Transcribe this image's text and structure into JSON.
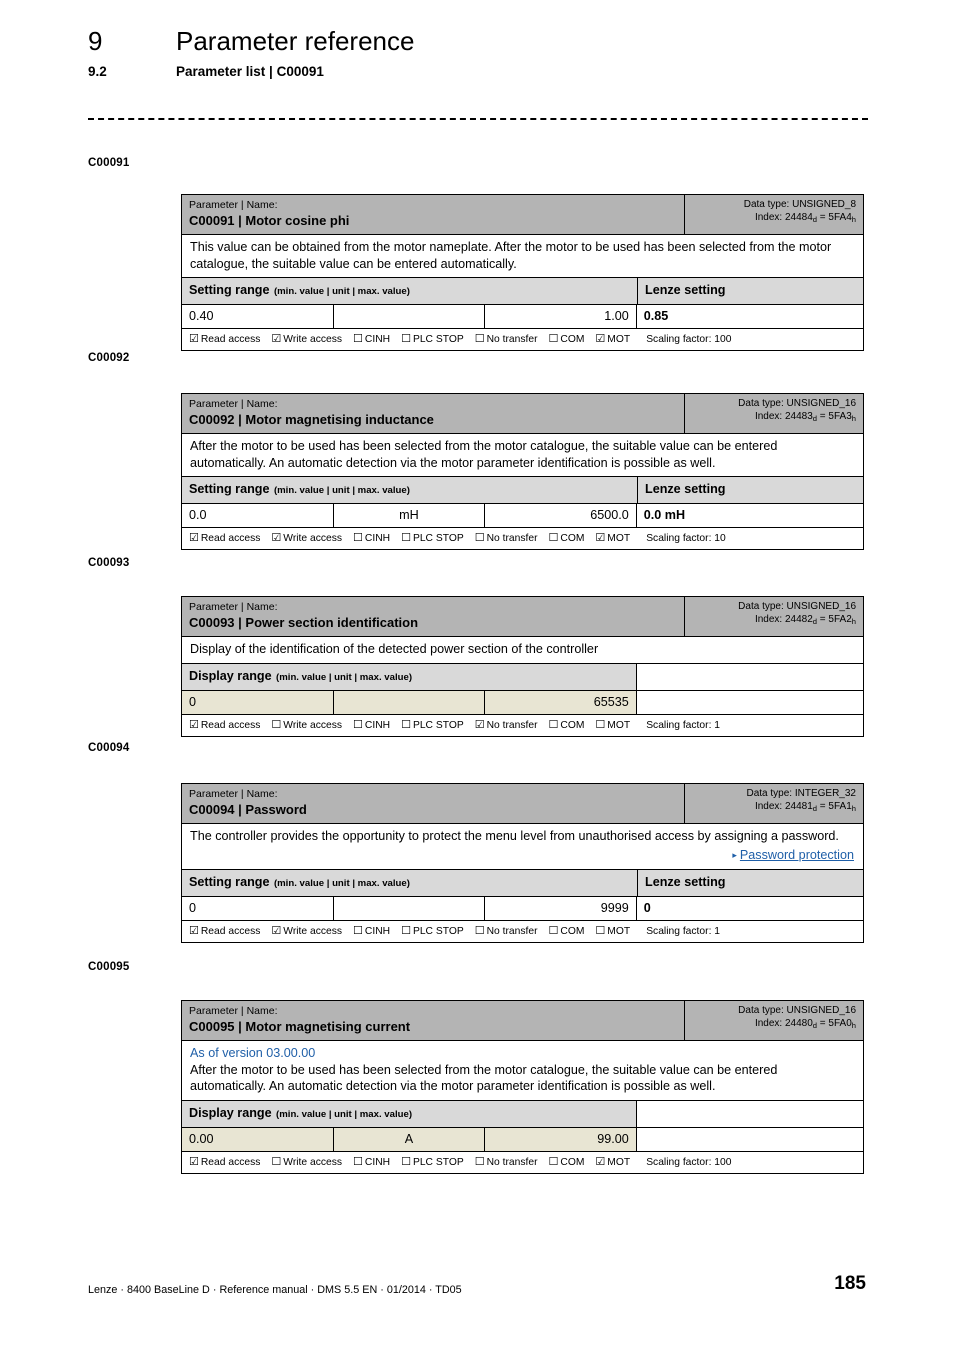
{
  "header": {
    "chapter_number": "9",
    "chapter_title": "Parameter reference",
    "section_number": "9.2",
    "section_title": "Parameter list | C00091"
  },
  "colors": {
    "header_band": "#B4B4B4",
    "range_band": "#D9D9D9",
    "value_beige": "#E8E5D3",
    "link_blue": "#1F5FA8"
  },
  "labels": {
    "parameter_name_kicker": "Parameter | Name:",
    "data_type_prefix": "Data type: ",
    "index_prefix": "Index: ",
    "setting_range": "Setting range",
    "display_range": "Display range",
    "range_sub": "(min. value | unit | max. value)",
    "lenze_setting": "Lenze setting",
    "read_access": "Read access",
    "write_access": "Write access",
    "cinh": "CINH",
    "plc_stop": "PLC STOP",
    "no_transfer": "No transfer",
    "com": "COM",
    "mot": "MOT",
    "scaling_factor_prefix": "Scaling factor: ",
    "checked_glyph": "☑",
    "unchecked_glyph": "☐",
    "xref_arrow_glyph": "▸"
  },
  "parameters": [
    {
      "margin_tag": "C00091",
      "code": "C00091",
      "name": "C00091 | Motor cosine phi",
      "data_type": "UNSIGNED_8",
      "index_dec": "24484",
      "index_hex": "5FA4",
      "description": "This value can be obtained from the motor nameplate. After the motor to be used has been selected from the motor catalogue, the suitable value can be entered automatically.",
      "as_of_version": "",
      "xref": "",
      "range_type": "Setting range",
      "min": "0.40",
      "unit": "",
      "max": "1.00",
      "lenze_value": "0.85",
      "has_lenze": true,
      "access": {
        "read": true,
        "write": true,
        "cinh": false,
        "plc_stop": false,
        "no_transfer": false,
        "com": false,
        "mot": true
      },
      "scaling_factor": "100"
    },
    {
      "margin_tag": "C00092",
      "code": "C00092",
      "name": "C00092 | Motor magnetising inductance",
      "data_type": "UNSIGNED_16",
      "index_dec": "24483",
      "index_hex": "5FA3",
      "description": "After the motor to be used has been selected from the motor catalogue, the suitable value can be entered automatically. An automatic detection via the motor parameter identification is possible as well.",
      "as_of_version": "",
      "xref": "",
      "range_type": "Setting range",
      "min": "0.0",
      "unit": "mH",
      "max": "6500.0",
      "lenze_value": "0.0 mH",
      "has_lenze": true,
      "access": {
        "read": true,
        "write": true,
        "cinh": false,
        "plc_stop": false,
        "no_transfer": false,
        "com": false,
        "mot": true
      },
      "scaling_factor": "10"
    },
    {
      "margin_tag": "C00093",
      "code": "C00093",
      "name": "C00093 | Power section identification",
      "data_type": "UNSIGNED_16",
      "index_dec": "24482",
      "index_hex": "5FA2",
      "description": "Display of the identification of the detected power section of the controller",
      "as_of_version": "",
      "xref": "",
      "range_type": "Display range",
      "min": "0",
      "unit": "",
      "max": "65535",
      "lenze_value": "",
      "has_lenze": false,
      "access": {
        "read": true,
        "write": false,
        "cinh": false,
        "plc_stop": false,
        "no_transfer": true,
        "com": false,
        "mot": false
      },
      "scaling_factor": "1"
    },
    {
      "margin_tag": "C00094",
      "code": "C00094",
      "name": "C00094 | Password",
      "data_type": "INTEGER_32",
      "index_dec": "24481",
      "index_hex": "5FA1",
      "description": "The controller provides the opportunity to protect the menu level from unauthorised access by assigning a password.",
      "as_of_version": "",
      "xref": "Password protection",
      "range_type": "Setting range",
      "min": "0",
      "unit": "",
      "max": "9999",
      "lenze_value": "0",
      "has_lenze": true,
      "access": {
        "read": true,
        "write": true,
        "cinh": false,
        "plc_stop": false,
        "no_transfer": false,
        "com": false,
        "mot": false
      },
      "scaling_factor": "1"
    },
    {
      "margin_tag": "C00095",
      "code": "C00095",
      "name": "C00095 | Motor magnetising current",
      "data_type": "UNSIGNED_16",
      "index_dec": "24480",
      "index_hex": "5FA0",
      "description": "After the motor to be used has been selected from the motor catalogue, the suitable value can be entered automatically. An automatic detection via the motor parameter identification is possible as well.",
      "as_of_version": "As of version 03.00.00",
      "xref": "",
      "range_type": "Display range",
      "min": "0.00",
      "unit": "A",
      "max": "99.00",
      "lenze_value": "",
      "has_lenze": false,
      "access": {
        "read": true,
        "write": false,
        "cinh": false,
        "plc_stop": false,
        "no_transfer": false,
        "com": false,
        "mot": true
      },
      "scaling_factor": "100"
    }
  ],
  "footer": {
    "text": "Lenze · 8400 BaseLine D · Reference manual · DMS 5.5 EN · 01/2014 · TD05",
    "page_number": "185"
  }
}
